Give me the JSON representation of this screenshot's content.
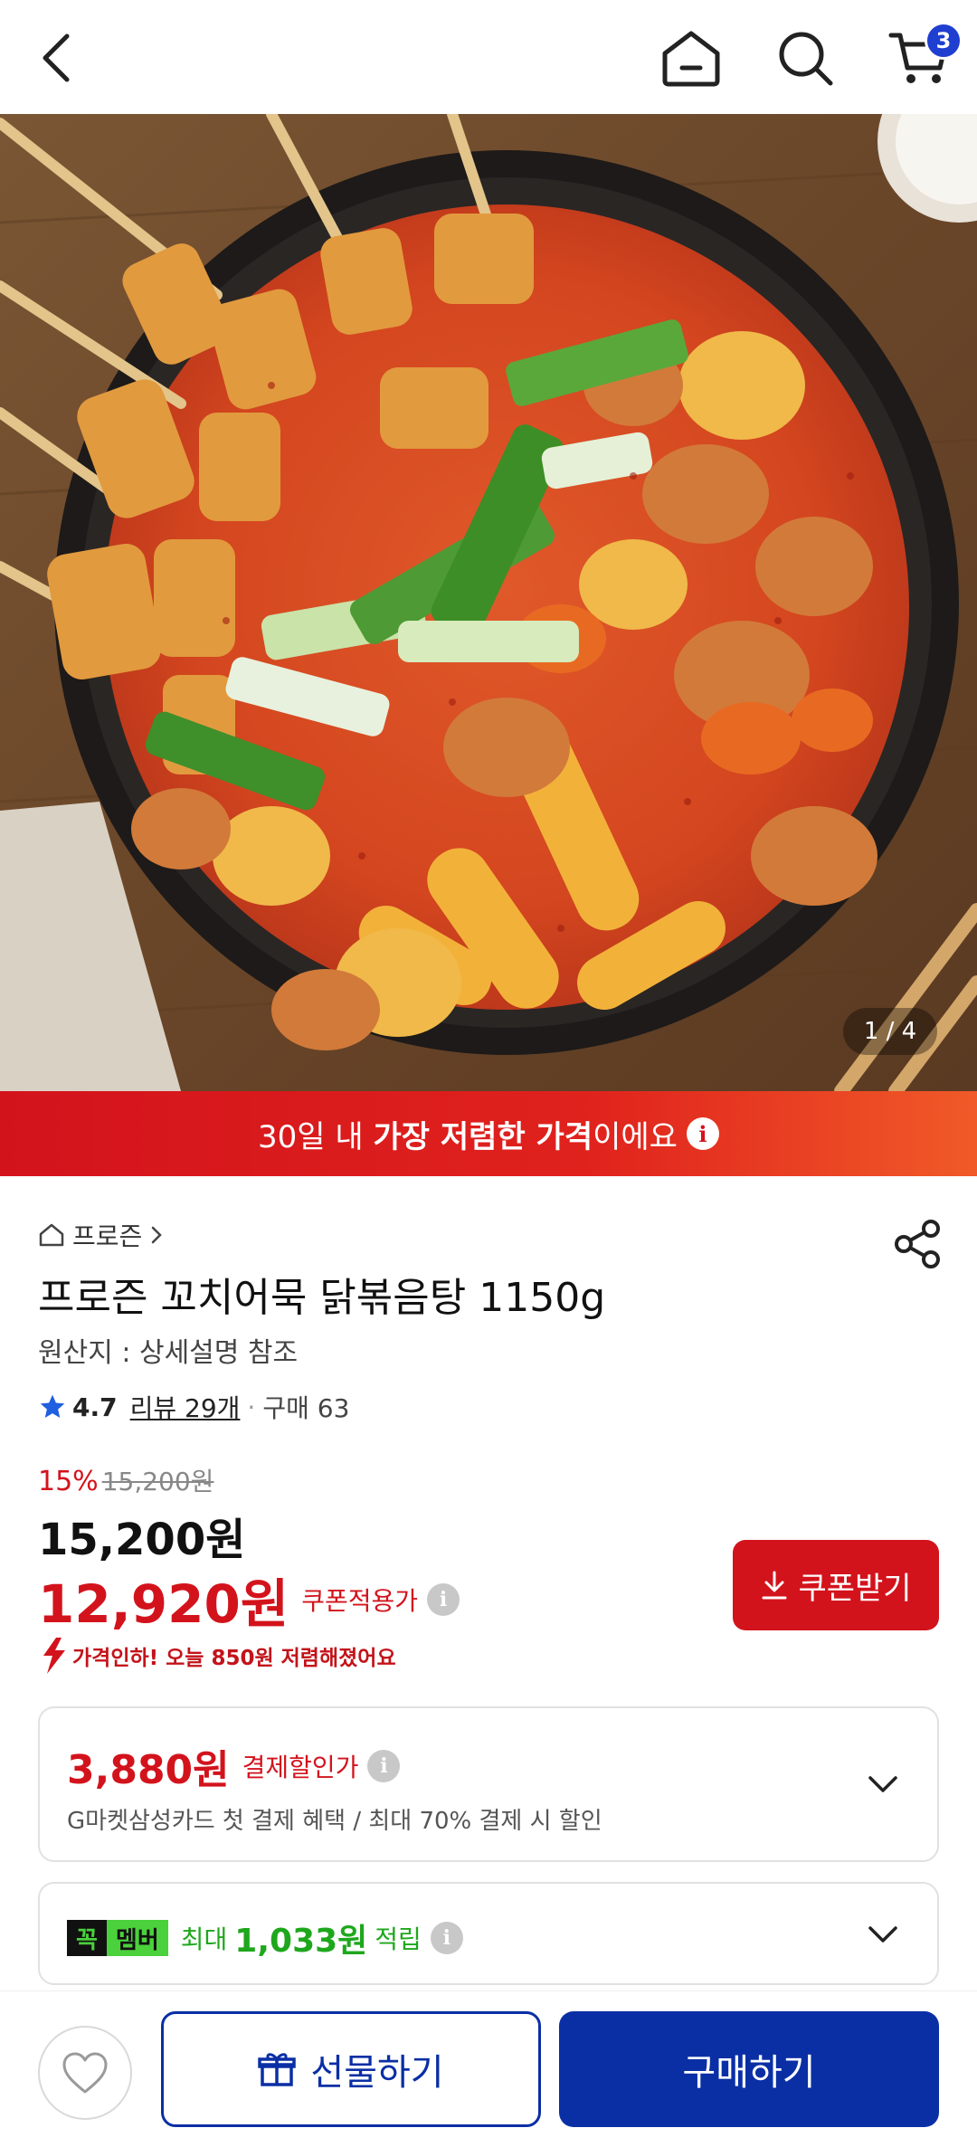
{
  "header": {
    "back_icon": "chevron-left-icon",
    "home_icon": "home-icon",
    "search_icon": "search-icon",
    "cart_icon": "cart-icon",
    "cart_count": "3"
  },
  "gallery": {
    "counter": "1 / 4"
  },
  "promo": {
    "prefix": "30일 내 ",
    "bold": "가장 저렴한 가격",
    "suffix": "이에요"
  },
  "product": {
    "category": "프로즌",
    "title": "프로즌 꼬치어묵 닭볶음탕 1150g",
    "origin": "원산지 : 상세설명 참조",
    "rating": "4.7",
    "review_link": "리뷰 29개",
    "sold": "구매 63"
  },
  "pricing": {
    "discount_pct": "15%",
    "original_price": "15,200원",
    "price": "15,200원",
    "coupon_price": "12,920원",
    "coupon_label": "쿠폰적용가",
    "coupon_button": "쿠폰받기",
    "price_drop_note": "가격인하! 오늘 850원 저렴해졌어요"
  },
  "payment_discount": {
    "amount": "3,880원",
    "label": "결제할인가",
    "description": "G마켓삼성카드 첫 결제 혜택 / 최대 70% 결제 시 할인"
  },
  "membership": {
    "badge_part1": "꼭",
    "badge_part2": "멤버",
    "max_label": "최대",
    "amount": "1,033원",
    "earn_label": "적립"
  },
  "actions": {
    "gift_button": "선물하기",
    "buy_button": "구매하기"
  },
  "colors": {
    "brand_red": "#d3131c",
    "brand_blue": "#0a2fa5",
    "member_green": "#4ad13b"
  }
}
